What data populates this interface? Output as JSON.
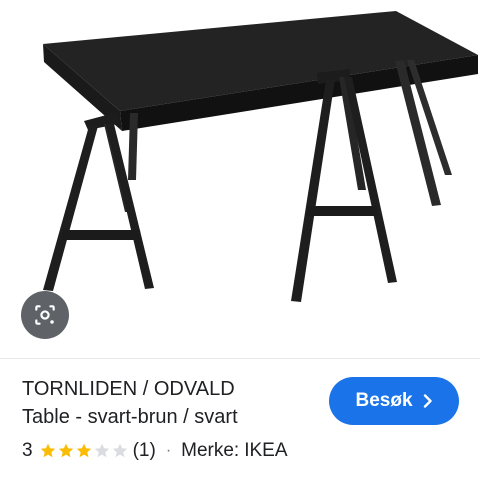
{
  "product": {
    "title": "TORNLIDEN / ODVALD",
    "subtitle": "Table - svart-brun / svart",
    "rating": {
      "value": "3",
      "stars": 3,
      "max_stars": 5,
      "reviews": "(1)"
    },
    "separator": "·",
    "brand_label": "Merke:",
    "brand": "IKEA"
  },
  "actions": {
    "visit_label": "Besøk"
  },
  "icons": {
    "lens": "google-lens-icon",
    "visit_chevron": "chevron-right-icon",
    "star_filled": "star-filled-icon",
    "star_empty": "star-empty-icon"
  },
  "colors": {
    "accent": "#1a73e8",
    "star": "#fbbc04",
    "star_empty": "#dadce0",
    "text": "#202124",
    "lens_bg": "#5f6368"
  }
}
